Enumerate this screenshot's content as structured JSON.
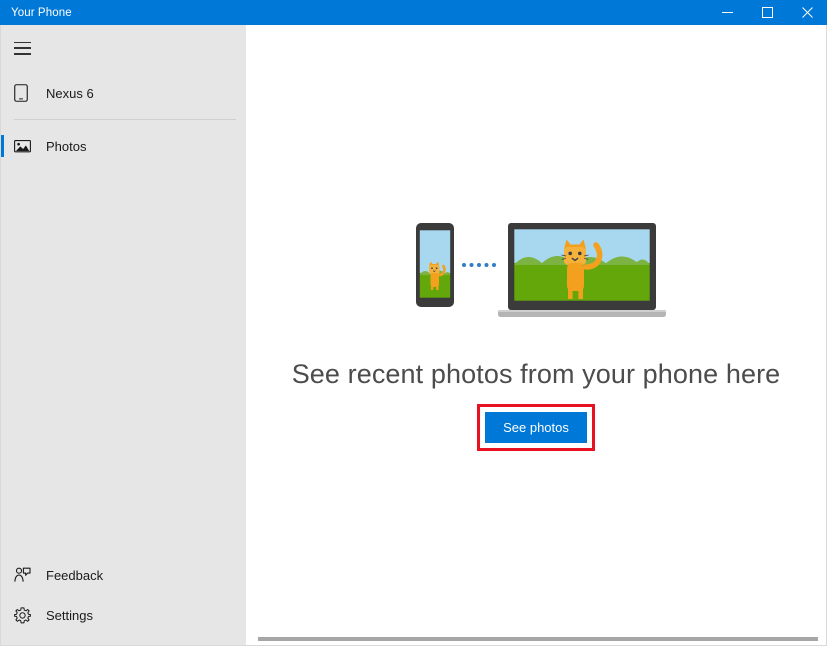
{
  "window": {
    "title": "Your Phone",
    "controls": [
      {
        "name": "minimize",
        "label": "Minimize"
      },
      {
        "name": "maximize",
        "label": "Maximize"
      },
      {
        "name": "close",
        "label": "Close"
      }
    ]
  },
  "sidebar": {
    "hamburger": {
      "icon": "hamburger-icon",
      "label": "Navigation menu"
    },
    "devices": [
      {
        "label": "Nexus 6",
        "icon": "phone-icon",
        "selected": false
      }
    ],
    "items": [
      {
        "label": "Photos",
        "icon": "photos-icon",
        "selected": true
      }
    ],
    "bottom_items": [
      {
        "label": "Feedback",
        "icon": "feedback-icon",
        "selected": false
      },
      {
        "label": "Settings",
        "icon": "gear-icon",
        "selected": false
      }
    ]
  },
  "content": {
    "illustration": {
      "name": "phone-to-laptop-photo-illustration",
      "alt": "Phone and laptop both showing a cat photo, connected by dots",
      "dots_count": 5
    },
    "headline": "See recent photos from your phone here",
    "primary_button": "See photos"
  },
  "annotation": {
    "highlight_color": "#e81123",
    "target": "See photos"
  },
  "colors": {
    "accent": "#0078d7",
    "titlebar": "#0078d7",
    "sidebar": "#e6e6e6",
    "content": "#ffffff",
    "headline_text": "#4c4c4c",
    "highlight": "#e81123",
    "illustration_sky": "#a8d8ef",
    "illustration_grass": "#64a70b",
    "illustration_hills": "#7cb342",
    "illustration_cat": "#f2a01e",
    "illustration_device": "#3b3b3b"
  }
}
